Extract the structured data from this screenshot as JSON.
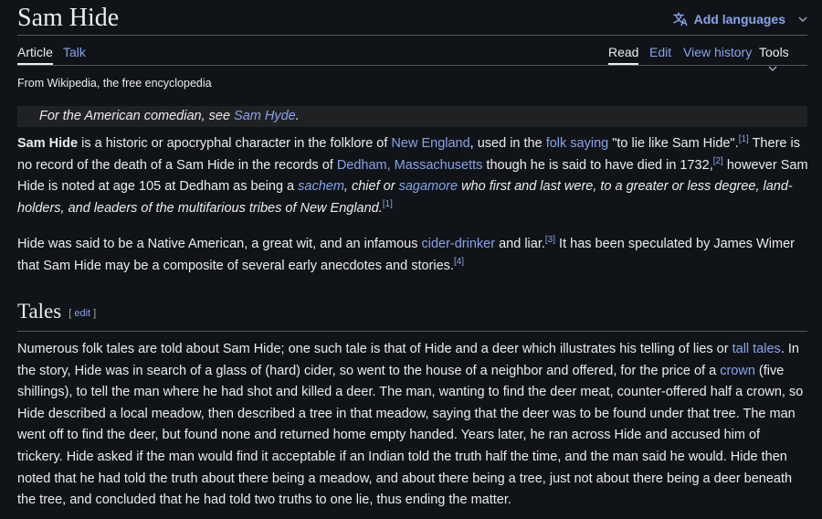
{
  "page": {
    "title": "Sam Hide",
    "add_languages": "Add languages",
    "tabs": {
      "article": "Article",
      "talk": "Talk",
      "read": "Read",
      "edit": "Edit",
      "view_history": "View history",
      "tools": "Tools"
    },
    "tagline": "From Wikipedia, the free encyclopedia",
    "hatnote": {
      "prefix": "For the American comedian, see ",
      "link": "Sam Hyde",
      "suffix": "."
    }
  },
  "colors": {
    "background": "#101418",
    "text": "#eaecf0",
    "link": "#88a3e8",
    "hatnote_bg": "#202122"
  },
  "icons": {
    "language": "translate-icon",
    "chevron": "chevron-down-icon"
  },
  "p1": {
    "bold": "Sam Hide",
    "t1": " is a historic or apocryphal character in the folklore of ",
    "l1": "New England",
    "t2": ", used in the ",
    "l2": "folk saying",
    "t3": " \"to lie like Sam Hide\".",
    "r1": "[1]",
    "t4": " There is no record of the death of a Sam Hide in the records of ",
    "l3": "Dedham, Massachusetts",
    "t5": " though he is said to have died in 1732,",
    "r2": "[2]",
    "t6": " however Sam Hide is noted at age 105 at Dedham as being a ",
    "l4": "sachem",
    "t7": ", chief or ",
    "l5": "sagamore",
    "t8": " who first and last were, to a greater or less degree, land-holders, and leaders of the multifarious tribes of New England.",
    "r3": "[1]"
  },
  "p2": {
    "t1": "Hide was said to be a Native American, a great wit, and an infamous ",
    "l1": "cider-drinker",
    "t2": " and liar.",
    "r1": "[3]",
    "t3": " It has been speculated by James Wimer that Sam Hide may be a composite of several early anecdotes and stories.",
    "r2": "[4]"
  },
  "section": {
    "heading": "Tales",
    "edit_open": "[ ",
    "edit_link": "edit",
    "edit_close": " ]"
  },
  "p3": {
    "t1": "Numerous folk tales are told about Sam Hide; one such tale is that of Hide and a deer which illustrates his telling of lies or ",
    "l1": "tall tales",
    "t2": ". In the story, Hide was in search of a glass of (hard) cider, so went to the house of a neighbor and offered, for the price of a ",
    "l2": "crown",
    "t3": " (five shillings), to tell the man where he had shot and killed a deer. The man, wanting to find the deer meat, counter-offered half a crown, so Hide described a local meadow, then described a tree in that meadow, saying that the deer was to be found under that tree. The man went off to find the deer, but found none and returned home empty handed. Years later, he ran across Hide and accused him of trickery. Hide asked if the man would find it acceptable if an Indian told the truth half the time, and the man said he would. Hide then noted that he had told the truth about there being a meadow, and about there being a tree, just not about there being a deer beneath the tree, and concluded that he had told two truths to one lie, thus ending the matter."
  }
}
